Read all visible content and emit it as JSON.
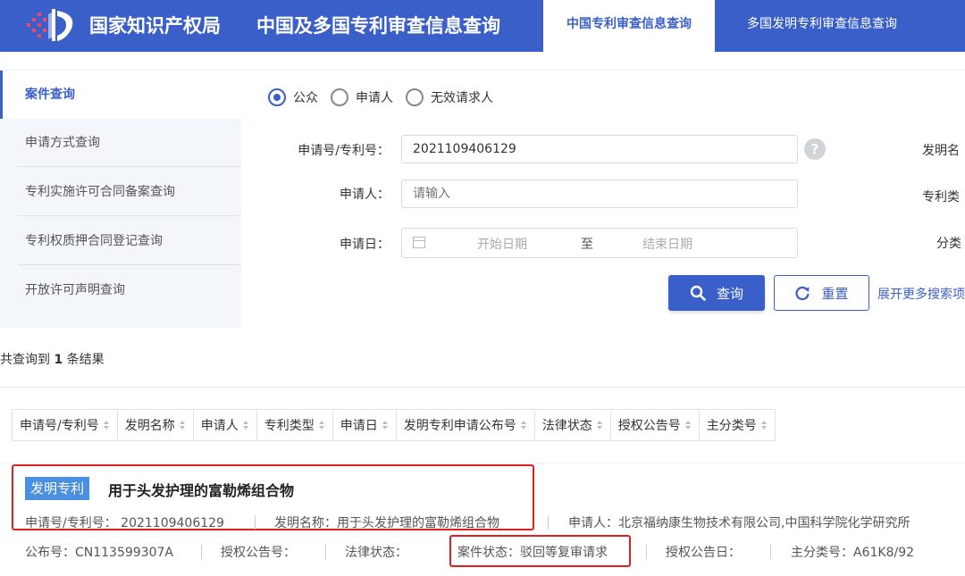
{
  "header": {
    "brand": "国家知识产权局",
    "title": "中国及多国专利审查信息查询",
    "tabs": [
      {
        "label": "中国专利审查信息查询",
        "active": true
      },
      {
        "label": "多国发明专利审查信息查询",
        "active": false
      }
    ],
    "accent_color": "#3a5fc8"
  },
  "sidebar": {
    "items": [
      {
        "label": "案件查询",
        "active": true
      },
      {
        "label": "申请方式查询"
      },
      {
        "label": "专利实施许可合同备案查询"
      },
      {
        "label": "专利权质押合同登记查询"
      },
      {
        "label": "开放许可声明查询"
      }
    ]
  },
  "search": {
    "roles": [
      {
        "label": "公众",
        "selected": true
      },
      {
        "label": "申请人",
        "selected": false
      },
      {
        "label": "无效请求人",
        "selected": false
      }
    ],
    "app_no_label": "申请号/专利号：",
    "app_no_value": "2021109406129",
    "help_glyph": "?",
    "applicant_label": "申请人：",
    "applicant_placeholder": "请输入",
    "date_label": "申请日：",
    "date_start_placeholder": "开始日期",
    "date_to": "至",
    "date_end_placeholder": "结束日期",
    "right_labels": [
      "发明名",
      "专利类",
      "分类"
    ],
    "search_button": "查询",
    "reset_button": "重置",
    "expand_link": "展开更多搜索项"
  },
  "results": {
    "count_prefix": "共查询到",
    "count": "1",
    "count_suffix": "条结果",
    "columns": [
      "申请号/专利号",
      "发明名称",
      "申请人",
      "专利类型",
      "申请日",
      "发明专利申请公布号",
      "法律状态",
      "授权公告号",
      "主分类号"
    ],
    "item": {
      "type_badge": "发明专利",
      "title": "用于头发护理的富勒烯组合物",
      "row1": [
        "申请号/专利号：  2021109406129",
        "发明名称：用于头发护理的富勒烯组合物",
        "申请人：北京福纳康生物技术有限公司,中国科学院化学研究所"
      ],
      "row2": [
        "公布号：CN113599307A",
        "授权公告号：",
        "法律状态：",
        "案件状态：驳回等复审请求",
        "授权公告日：",
        "主分类号：A61K8/92"
      ],
      "badge_color": "#4b8fe0",
      "highlight_color": "#e02020"
    }
  }
}
